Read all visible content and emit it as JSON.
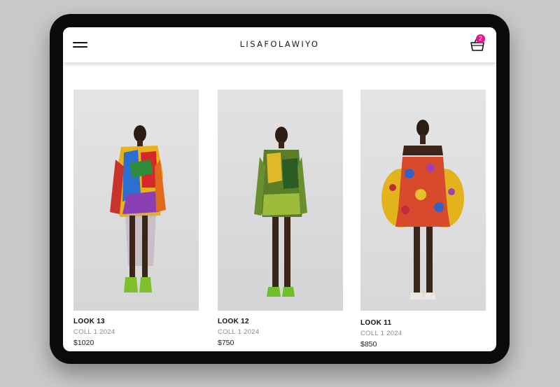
{
  "header": {
    "brand": "LISAFOLAWIYO",
    "cart_count": "2",
    "accent_color": "#e2158a"
  },
  "products": [
    {
      "look": "LOOK 13",
      "collection": "COLL 1 2024",
      "price": "$1020"
    },
    {
      "look": "LOOK 12",
      "collection": "COLL 1 2024",
      "price": "$750"
    },
    {
      "look": "LOOK 11",
      "collection": "COLL 1 2024",
      "price": "$850"
    }
  ]
}
